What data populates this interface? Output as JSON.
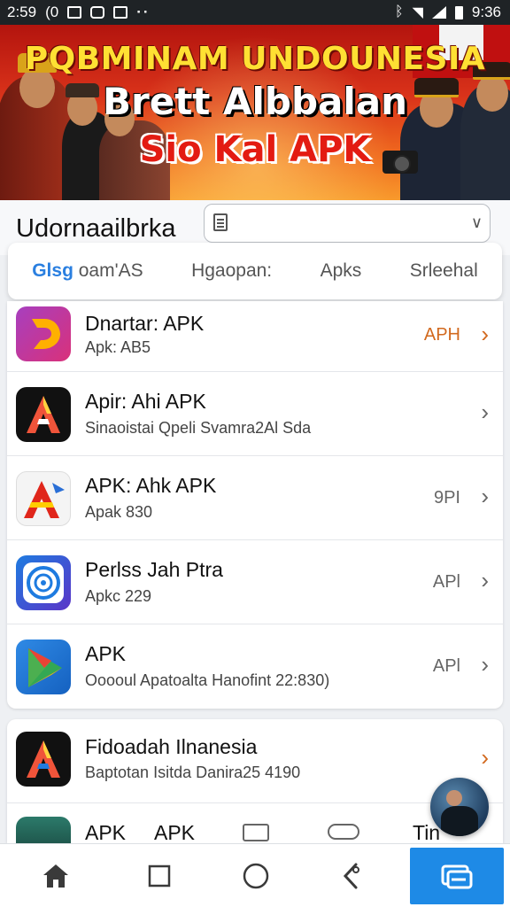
{
  "status_bar": {
    "time": "2:59",
    "left_glyph": "(0",
    "right_time": "9:36"
  },
  "banner": {
    "line1": "PQBMINAM UNDOUNESIA",
    "line2": "Brett Albbalan",
    "line3": "Sio Kal APK",
    "colors": {
      "red": "#b3140e",
      "orange": "#f06a1e",
      "yellow": "#ffe033"
    }
  },
  "header": {
    "app_title": "Udornaailbrka",
    "search_value": "",
    "search_placeholder": ""
  },
  "tabs": [
    {
      "accent": "Glsg",
      "label": " oam'AS",
      "active": true
    },
    {
      "label": "Hgaopan:"
    },
    {
      "label": "Apks"
    },
    {
      "label": "Srleehal"
    }
  ],
  "apps": [
    {
      "title": "Dnartar: APK",
      "subtitle": "Apk: AB5",
      "badge": "APH",
      "icon": "d-logo-icon"
    },
    {
      "title": "Apir: Ahi APK",
      "subtitle": "Sinaoistai Qpeli Svamra2Al Sda",
      "badge": "",
      "icon": "a-logo-dark-icon"
    },
    {
      "title": "APK: Ahk APK",
      "subtitle": "Apak 830",
      "badge": "9PI",
      "icon": "a-logo-red-icon"
    },
    {
      "title": "Perlss Jah Ptra",
      "subtitle": "Apkc 229",
      "badge": "APl",
      "icon": "target-logo-icon"
    },
    {
      "title": "APK",
      "subtitle": "Ooooul Apatoalta Hanofint 22:830)",
      "badge": "APl",
      "icon": "play-logo-icon"
    }
  ],
  "apps_more": [
    {
      "title": "Fidoadah Ilnanesia",
      "subtitle": "Baptotan Isitda Danira25 4190",
      "icon": "a-logo-dark-icon"
    }
  ],
  "partial_row": {
    "texts": [
      "APK",
      "APK",
      "Tin"
    ]
  },
  "bottom_nav": [
    {
      "name": "home"
    },
    {
      "name": "square"
    },
    {
      "name": "circle"
    },
    {
      "name": "back"
    },
    {
      "name": "apps",
      "active": true
    }
  ]
}
